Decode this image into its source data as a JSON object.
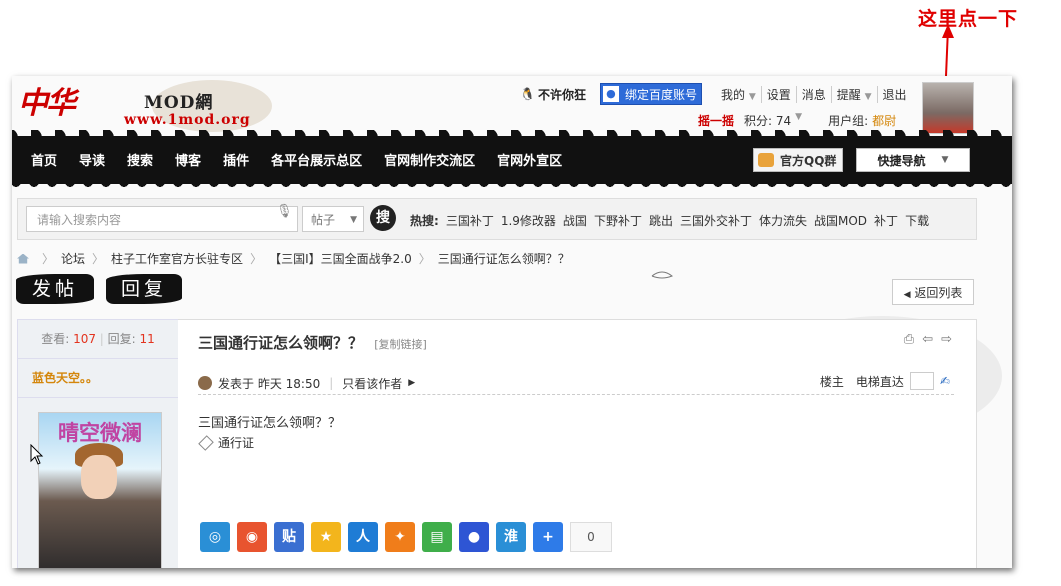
{
  "annotation": {
    "text": "这里点一下"
  },
  "header": {
    "logo_cn": "中华",
    "logo_mod": "MOD網",
    "logo_url": "www.1mod.org",
    "username": "不许你狂",
    "bind_label": "绑定百度账号",
    "menu": [
      "我的",
      "设置",
      "消息",
      "提醒",
      "退出"
    ],
    "shake": "摇一摇",
    "points": "积分: 74",
    "group_label": "用户组:",
    "group_value": "都尉"
  },
  "nav": {
    "items": [
      "首页",
      "导读",
      "搜索",
      "博客",
      "插件",
      "各平台展示总区",
      "官网制作交流区",
      "官网外宣区"
    ],
    "qq_label": "官方QQ群",
    "quick_nav": "快捷导航"
  },
  "search": {
    "placeholder": "请输入搜索内容",
    "type": "帖子",
    "button": "搜",
    "hot_label": "热搜:",
    "hot": [
      "三国补丁",
      "1.9修改器",
      "战国",
      "下野补丁",
      "跳出",
      "三国外交补丁",
      "体力流失",
      "战国MOD",
      "补丁",
      "下载"
    ]
  },
  "breadcrumb": [
    "论坛",
    "柱子工作室官方长驻专区",
    "【三国Ⅰ】三国全面战争2.0",
    "三国通行证怎么领啊？？"
  ],
  "actions": {
    "post": "发帖",
    "reply": "回复",
    "back": "返回列表"
  },
  "stats": {
    "views_label": "查看:",
    "views": "107",
    "replies_label": "回复:",
    "replies": "11"
  },
  "author": {
    "name": "蓝色天空。。",
    "avatar_text": "晴空微澜"
  },
  "post": {
    "title": "三国通行证怎么领啊？？",
    "copy_link": "[复制链接]",
    "posted": "发表于 昨天 18:50",
    "only_author": "只看该作者",
    "floor": "楼主",
    "elevator": "电梯直达",
    "body": "三国通行证怎么领啊？？",
    "tag": "通行证"
  },
  "share": {
    "count": "0"
  },
  "colors": {
    "accent": "#c00000",
    "nav_bg": "#111111",
    "link_blue": "#2e6bd8",
    "gold": "#d4860a"
  }
}
